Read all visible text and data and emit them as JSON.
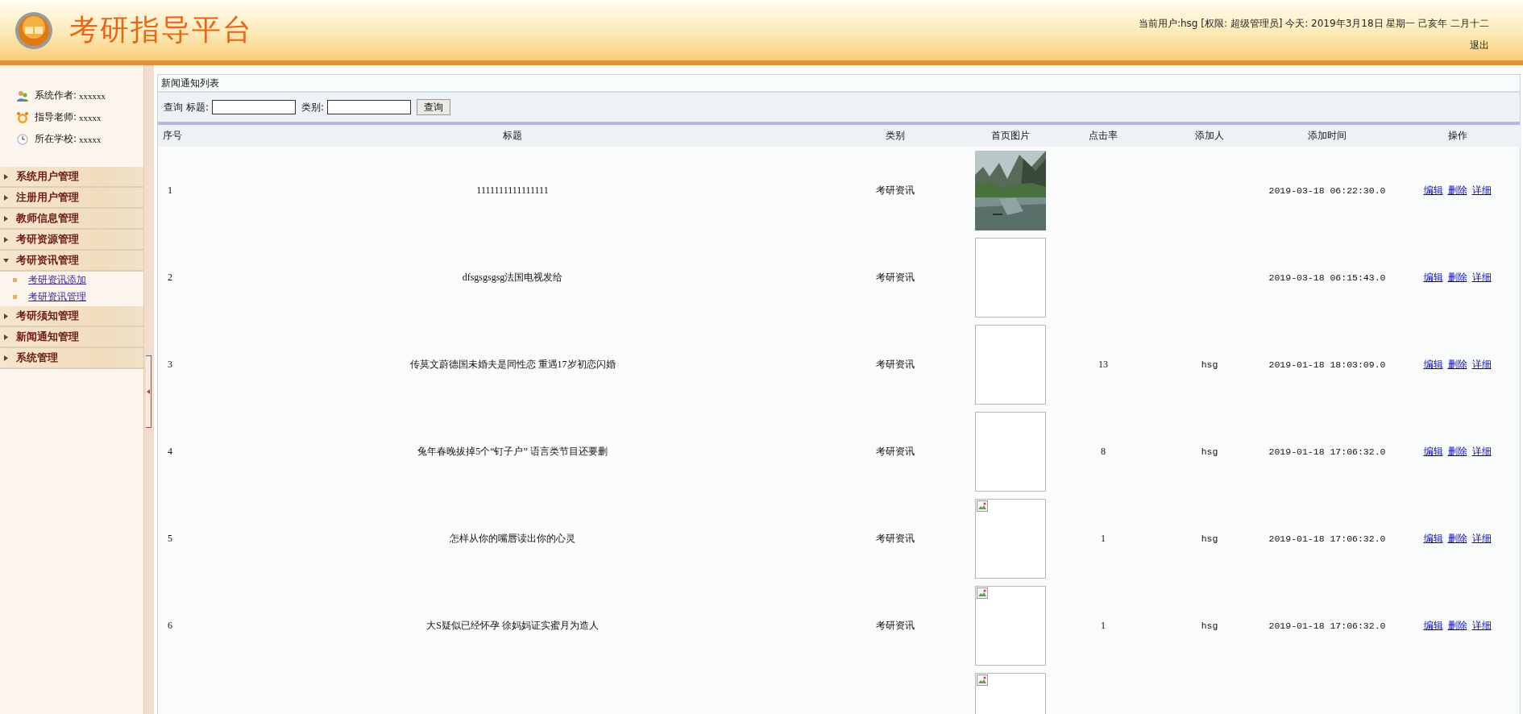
{
  "header": {
    "title": "考研指导平台",
    "user_info": "当前用户:hsg [权限: 超级管理员] 今天:  2019年3月18日 星期一 己亥年 二月十二",
    "logout": "退出"
  },
  "sidebar": {
    "info": [
      {
        "kind": "people",
        "label": "系统作者:",
        "value": "xxxxxx"
      },
      {
        "kind": "clock",
        "label": "指导老师:",
        "value": "xxxxx"
      },
      {
        "kind": "timer",
        "label": "所在学校:",
        "value": "xxxxx"
      }
    ],
    "menu": [
      {
        "label": "系统用户管理",
        "expanded": false
      },
      {
        "label": "注册用户管理",
        "expanded": false
      },
      {
        "label": "教师信息管理",
        "expanded": false
      },
      {
        "label": "考研资源管理",
        "expanded": false
      },
      {
        "label": "考研资讯管理",
        "expanded": true,
        "children": [
          {
            "label": "考研资讯添加"
          },
          {
            "label": "考研资讯管理"
          }
        ]
      },
      {
        "label": "考研须知管理",
        "expanded": false
      },
      {
        "label": "新闻通知管理",
        "expanded": false
      },
      {
        "label": "系统管理",
        "expanded": false
      }
    ]
  },
  "panel": {
    "title": "新闻通知列表",
    "search": {
      "label": "查询",
      "fields": [
        {
          "label": "标题:"
        },
        {
          "label": "类别:"
        }
      ],
      "button": "查询"
    },
    "table": {
      "columns": [
        "序号",
        "标题",
        "类别",
        "首页图片",
        "点击率",
        "添加人",
        "添加时间",
        "操作"
      ],
      "rows": [
        {
          "no": "1",
          "title": "1111111111111111",
          "category": "考研资讯",
          "time": "2019-03-18 06:22:30.0",
          "actions": [
            "编辑",
            "删除",
            "详细"
          ]
        },
        {
          "no": "2",
          "title": "dfsgsgsgsg法国电视发给",
          "category": "考研资讯",
          "image": {
            "kind": "blank"
          },
          "time": "2019-03-18 06:15:43.0",
          "actions": [
            "编辑",
            "删除",
            "详细"
          ]
        },
        {
          "no": "3",
          "title": "传莫文蔚德国未婚夫是同性恋 重遇17岁初恋闪婚",
          "category": "考研资讯",
          "image": {
            "kind": "blank"
          },
          "clicks": "13",
          "adder": "hsg",
          "time": "2019-01-18 18:03:09.0",
          "actions": [
            "编辑",
            "删除",
            "详细"
          ]
        },
        {
          "no": "4",
          "title": "兔年春晚拔掉5个“钉子户” 语言类节目还要删",
          "category": "考研资讯",
          "image": {
            "kind": "blank"
          },
          "clicks": "8",
          "adder": "hsg",
          "time": "2019-01-18 17:06:32.0",
          "actions": [
            "编辑",
            "删除",
            "详细"
          ]
        },
        {
          "no": "5",
          "title": "怎样从你的嘴唇读出你的心灵",
          "category": "考研资讯",
          "image": {
            "kind": "broken"
          },
          "clicks": "1",
          "adder": "hsg",
          "time": "2019-01-18 17:06:32.0",
          "actions": [
            "编辑",
            "删除",
            "详细"
          ]
        },
        {
          "no": "6",
          "title": "大S疑似已经怀孕 徐妈妈证实蜜月为造人",
          "category": "考研资讯",
          "image": {
            "kind": "broken"
          },
          "clicks": "1",
          "adder": "hsg",
          "time": "2019-01-18 17:06:32.0",
          "actions": [
            "编辑",
            "删除",
            "详细"
          ]
        },
        {
          "image": {
            "kind": "broken"
          }
        }
      ]
    }
  }
}
